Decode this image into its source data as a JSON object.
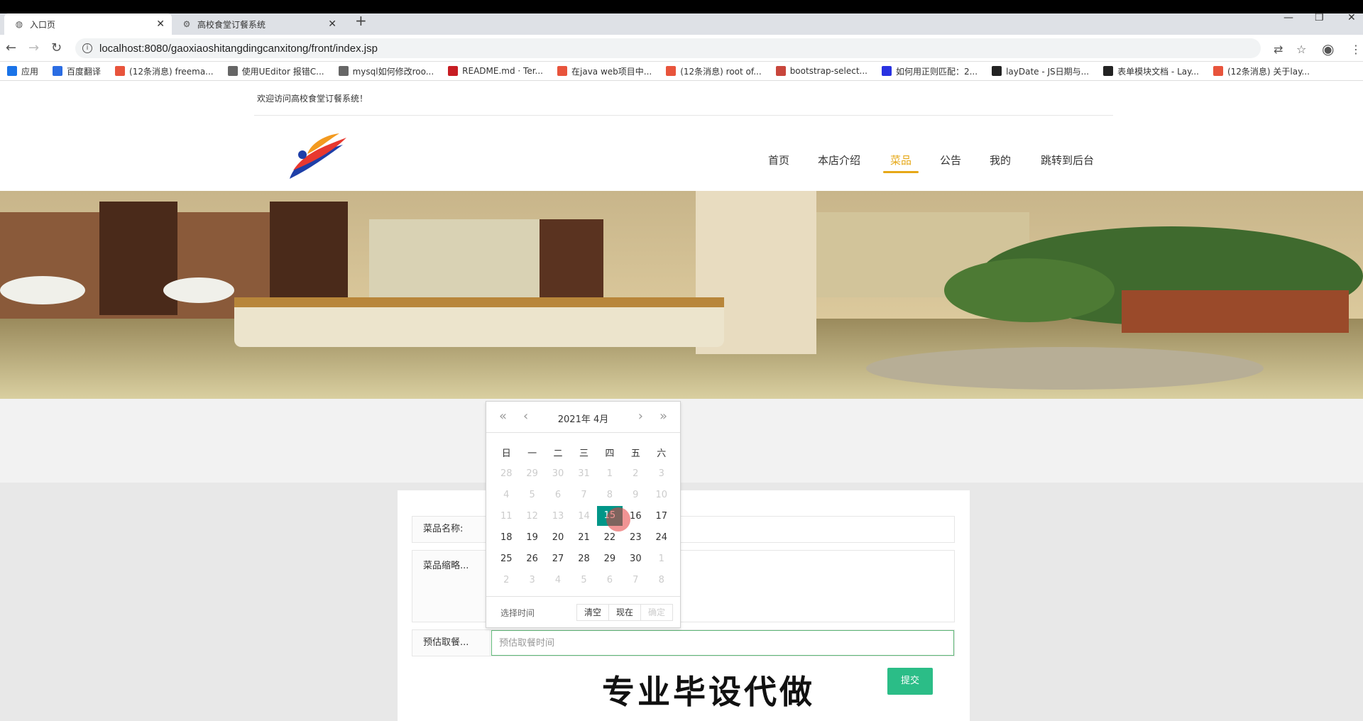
{
  "browser": {
    "tabs": [
      {
        "title": "入口页",
        "icon": "globe-icon",
        "active": true
      },
      {
        "title": "高校食堂订餐系统",
        "icon": "settings-icon",
        "active": false
      }
    ],
    "new_tab": "+",
    "url": "localhost:8080/gaoxiaoshitangdingcanxitong/front/index.jsp"
  },
  "bookmarks": [
    {
      "label": "应用",
      "icon": "apps-icon",
      "color": "#1a73e8"
    },
    {
      "label": "百度翻译",
      "icon": "translate-icon",
      "color": "#2b6de3"
    },
    {
      "label": "(12条消息) freema...",
      "icon": "csdn-icon",
      "color": "#e8543c"
    },
    {
      "label": "使用UEditor 报错C...",
      "icon": "ueditor-icon",
      "color": "#666666"
    },
    {
      "label": "mysql如何修改roo...",
      "icon": "mysql-icon",
      "color": "#666666"
    },
    {
      "label": "README.md · Ter...",
      "icon": "gitee-icon",
      "color": "#c71d23"
    },
    {
      "label": "在java web项目中...",
      "icon": "csdn-icon",
      "color": "#e8543c"
    },
    {
      "label": "(12条消息) root of...",
      "icon": "csdn-icon",
      "color": "#e8543c"
    },
    {
      "label": "bootstrap-select...",
      "icon": "cnblogs-icon",
      "color": "#c8463c"
    },
    {
      "label": "如何用正则匹配：2...",
      "icon": "baidu-icon",
      "color": "#2932e1"
    },
    {
      "label": "layDate - JS日期与...",
      "icon": "layui-icon",
      "color": "#222222"
    },
    {
      "label": "表单模块文档 - Lay...",
      "icon": "layui-icon",
      "color": "#222222"
    },
    {
      "label": "(12条消息) 关于lay...",
      "icon": "csdn-icon",
      "color": "#e8543c"
    }
  ],
  "page": {
    "welcome": "欢迎访问高校食堂订餐系统！",
    "nav": [
      "首页",
      "本店介绍",
      "菜品",
      "公告",
      "我的",
      "跳转到后台"
    ],
    "nav_active": "菜品",
    "accent": "#e6a817"
  },
  "form": {
    "dish_name_label": "菜品名称:",
    "dish_thumb_label": "菜品缩略...",
    "pickup_label": "预估取餐...",
    "pickup_placeholder": "预估取餐时间",
    "submit": "提交",
    "big_text": "专业毕设代做"
  },
  "datepicker": {
    "year_month": "2021年  4月",
    "weekdays": [
      "日",
      "一",
      "二",
      "三",
      "四",
      "五",
      "六"
    ],
    "weeks": [
      [
        "28",
        "29",
        "30",
        "31",
        "1",
        "2",
        "3"
      ],
      [
        "4",
        "5",
        "6",
        "7",
        "8",
        "9",
        "10"
      ],
      [
        "11",
        "12",
        "13",
        "14",
        "15",
        "16",
        "17"
      ],
      [
        "18",
        "19",
        "20",
        "21",
        "22",
        "23",
        "24"
      ],
      [
        "25",
        "26",
        "27",
        "28",
        "29",
        "30",
        "1"
      ],
      [
        "2",
        "3",
        "4",
        "5",
        "6",
        "7",
        "8"
      ]
    ],
    "selected": "15",
    "select_time": "选择时间",
    "clear": "清空",
    "now": "现在",
    "confirm": "确定"
  }
}
